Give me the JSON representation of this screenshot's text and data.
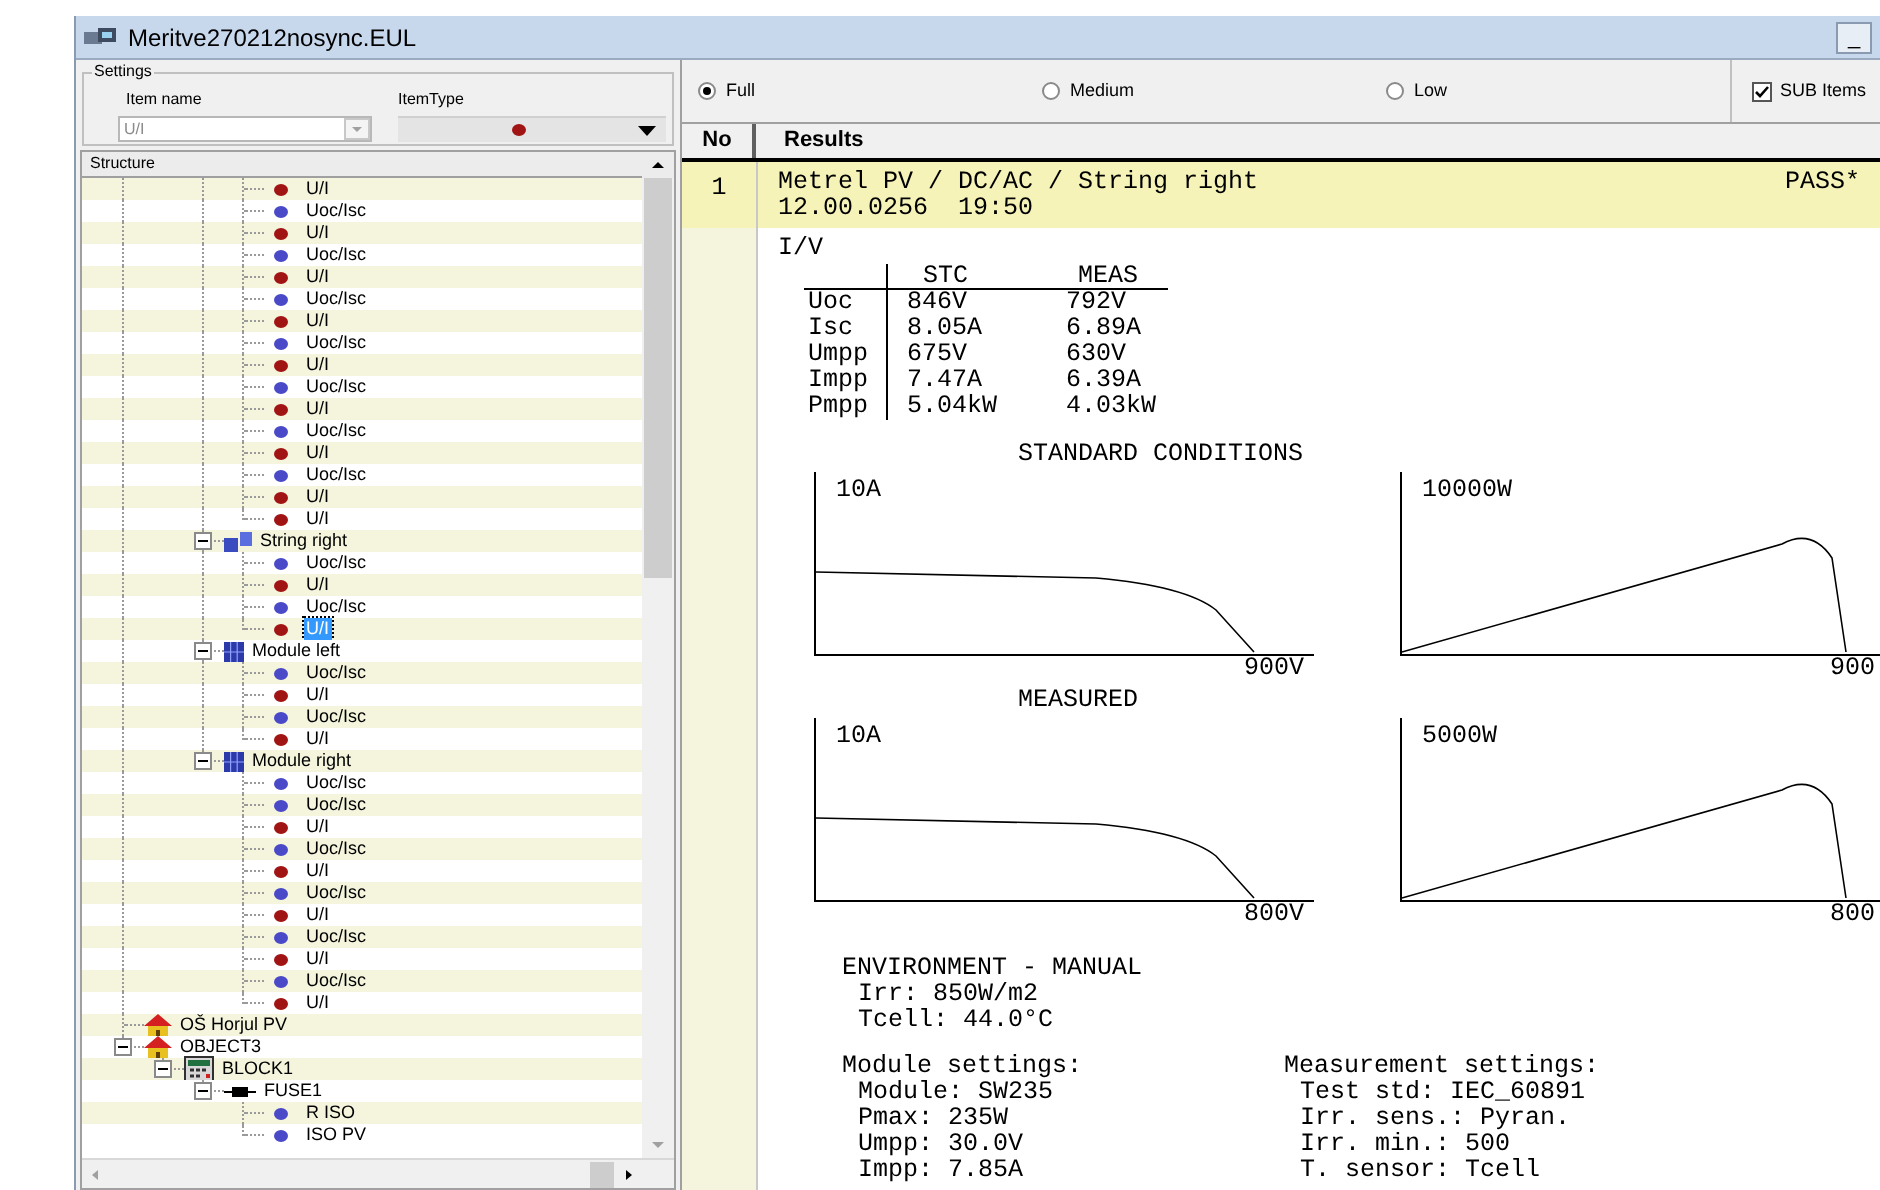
{
  "window": {
    "title": "Meritve270212nosync.EUL",
    "buttons": [
      "_"
    ]
  },
  "settings": {
    "title": "Settings",
    "item_name": {
      "label": "Item name",
      "value": "U/I",
      "disabled": true
    },
    "item_type": {
      "label": "ItemType",
      "color": "#a01414"
    }
  },
  "structure": {
    "title": "Structure",
    "tree": [
      {
        "children": [
          {
            "children": [
              {
                "children": [
                  {
                    "kind": "measurement",
                    "label": "U/I",
                    "color": "#a01414",
                    "selected": false
                  },
                  {
                    "kind": "measurement",
                    "label": "Uoc/Isc",
                    "color": "#4a4ac8",
                    "selected": false
                  },
                  {
                    "kind": "measurement",
                    "label": "U/I",
                    "color": "#a01414",
                    "selected": false
                  },
                  {
                    "kind": "measurement",
                    "label": "Uoc/Isc",
                    "color": "#4a4ac8",
                    "selected": false
                  },
                  {
                    "kind": "measurement",
                    "label": "U/I",
                    "color": "#a01414",
                    "selected": false
                  },
                  {
                    "kind": "measurement",
                    "label": "Uoc/Isc",
                    "color": "#4a4ac8",
                    "selected": false
                  },
                  {
                    "kind": "measurement",
                    "label": "U/I",
                    "color": "#a01414",
                    "selected": false
                  },
                  {
                    "kind": "measurement",
                    "label": "Uoc/Isc",
                    "color": "#4a4ac8",
                    "selected": false
                  },
                  {
                    "kind": "measurement",
                    "label": "U/I",
                    "color": "#a01414",
                    "selected": false
                  },
                  {
                    "kind": "measurement",
                    "label": "Uoc/Isc",
                    "color": "#4a4ac8",
                    "selected": false
                  },
                  {
                    "kind": "measurement",
                    "label": "U/I",
                    "color": "#a01414",
                    "selected": false
                  },
                  {
                    "kind": "measurement",
                    "label": "Uoc/Isc",
                    "color": "#4a4ac8",
                    "selected": false
                  },
                  {
                    "kind": "measurement",
                    "label": "U/I",
                    "color": "#a01414",
                    "selected": false
                  },
                  {
                    "kind": "measurement",
                    "label": "Uoc/Isc",
                    "color": "#4a4ac8",
                    "selected": false
                  },
                  {
                    "kind": "measurement",
                    "label": "U/I",
                    "color": "#a01414",
                    "selected": false
                  },
                  {
                    "kind": "measurement",
                    "label": "U/I",
                    "color": "#a01414",
                    "selected": false
                  }
                ]
              },
              {
                "kind": "string",
                "label": "String right",
                "expanded": true,
                "selected": false,
                "children": [
                  {
                    "kind": "measurement",
                    "label": "Uoc/Isc",
                    "color": "#4a4ac8",
                    "selected": false
                  },
                  {
                    "kind": "measurement",
                    "label": "U/I",
                    "color": "#a01414",
                    "selected": false
                  },
                  {
                    "kind": "measurement",
                    "label": "Uoc/Isc",
                    "color": "#4a4ac8",
                    "selected": false
                  },
                  {
                    "kind": "measurement",
                    "label": "U/I",
                    "color": "#a01414",
                    "selected": true
                  }
                ]
              },
              {
                "kind": "module",
                "label": "Module left",
                "expanded": true,
                "selected": false,
                "children": [
                  {
                    "kind": "measurement",
                    "label": "Uoc/Isc",
                    "color": "#4a4ac8",
                    "selected": false
                  },
                  {
                    "kind": "measurement",
                    "label": "U/I",
                    "color": "#a01414",
                    "selected": false
                  },
                  {
                    "kind": "measurement",
                    "label": "Uoc/Isc",
                    "color": "#4a4ac8",
                    "selected": false
                  },
                  {
                    "kind": "measurement",
                    "label": "U/I",
                    "color": "#a01414",
                    "selected": false
                  }
                ]
              },
              {
                "kind": "module",
                "label": "Module right",
                "expanded": true,
                "selected": false,
                "children": [
                  {
                    "kind": "measurement",
                    "label": "Uoc/Isc",
                    "color": "#4a4ac8",
                    "selected": false
                  },
                  {
                    "kind": "measurement",
                    "label": "Uoc/Isc",
                    "color": "#4a4ac8",
                    "selected": false
                  },
                  {
                    "kind": "measurement",
                    "label": "U/I",
                    "color": "#a01414",
                    "selected": false
                  },
                  {
                    "kind": "measurement",
                    "label": "Uoc/Isc",
                    "color": "#4a4ac8",
                    "selected": false
                  },
                  {
                    "kind": "measurement",
                    "label": "U/I",
                    "color": "#a01414",
                    "selected": false
                  },
                  {
                    "kind": "measurement",
                    "label": "Uoc/Isc",
                    "color": "#4a4ac8",
                    "selected": false
                  },
                  {
                    "kind": "measurement",
                    "label": "U/I",
                    "color": "#a01414",
                    "selected": false
                  },
                  {
                    "kind": "measurement",
                    "label": "Uoc/Isc",
                    "color": "#4a4ac8",
                    "selected": false
                  },
                  {
                    "kind": "measurement",
                    "label": "U/I",
                    "color": "#a01414",
                    "selected": false
                  },
                  {
                    "kind": "measurement",
                    "label": "Uoc/Isc",
                    "color": "#4a4ac8",
                    "selected": false
                  },
                  {
                    "kind": "measurement",
                    "label": "U/I",
                    "color": "#a01414",
                    "selected": false
                  }
                ]
              }
            ]
          }
        ]
      },
      {
        "kind": "object",
        "label": "OŠ Horjul PV",
        "selected": false
      },
      {
        "kind": "object",
        "label": "OBJECT3",
        "expanded": true,
        "selected": false,
        "children": [
          {
            "kind": "block",
            "label": "BLOCK1",
            "expanded": true,
            "selected": false,
            "children": [
              {
                "kind": "fuse",
                "label": "FUSE1",
                "expanded": true,
                "selected": false,
                "children": [
                  {
                    "kind": "measurement",
                    "label": "R ISO",
                    "color": "#4a4ac8",
                    "selected": false
                  },
                  {
                    "kind": "measurement",
                    "label": "ISO PV",
                    "color": "#4a4ac8",
                    "selected": false
                  }
                ]
              }
            ]
          }
        ]
      }
    ]
  },
  "detail_levels": [
    {
      "label": "Full",
      "selected": true
    },
    {
      "label": "Medium",
      "selected": false
    },
    {
      "label": "Low",
      "selected": false
    }
  ],
  "sub_items": {
    "label": "SUB Items",
    "checked": true
  },
  "results": {
    "columns": [
      "No",
      "Results"
    ],
    "rows": [
      {
        "no": "1",
        "title": "Metrel PV / DC/AC / String right",
        "date": "12.00.0256  19:50",
        "status": "PASS*",
        "selected": true,
        "section": "I/V",
        "iv_table": {
          "columns": [
            "",
            "STC",
            "MEAS"
          ],
          "rows": [
            [
              "Uoc",
              "846V",
              "792V"
            ],
            [
              "Isc",
              "8.05A",
              "6.89A"
            ],
            [
              "Umpp",
              "675V",
              "630V"
            ],
            [
              "Impp",
              "7.47A",
              "6.39A"
            ],
            [
              "Pmpp",
              "5.04kW",
              "4.03kW"
            ]
          ]
        },
        "chart_groups": [
          {
            "title": "STANDARD CONDITIONS",
            "plots": [
              {
                "kind": "current",
                "top_label": "10A",
                "bottom_label": "900V"
              },
              {
                "kind": "power",
                "top_label": "10000W",
                "bottom_label": "900"
              }
            ]
          },
          {
            "title": "MEASURED",
            "plots": [
              {
                "kind": "current",
                "top_label": "10A",
                "bottom_label": "800V"
              },
              {
                "kind": "power",
                "top_label": "5000W",
                "bottom_label": "800"
              }
            ]
          }
        ],
        "environment": {
          "title": "ENVIRONMENT - MANUAL",
          "lines": [
            "Irr: 850W/m2",
            "Tcell: 44.0°C"
          ]
        },
        "settings_blocks": [
          {
            "title": "Module settings:",
            "lines": [
              "Module: SW235",
              "Pmax: 235W",
              "Umpp: 30.0V",
              "Impp: 7.85A"
            ]
          },
          {
            "title": "Measurement settings:",
            "lines": [
              "Test std: IEC_60891",
              "Irr. sens.: Pyran.",
              "Irr. min.: 500",
              "T. sensor: Tcell"
            ]
          }
        ]
      }
    ]
  }
}
